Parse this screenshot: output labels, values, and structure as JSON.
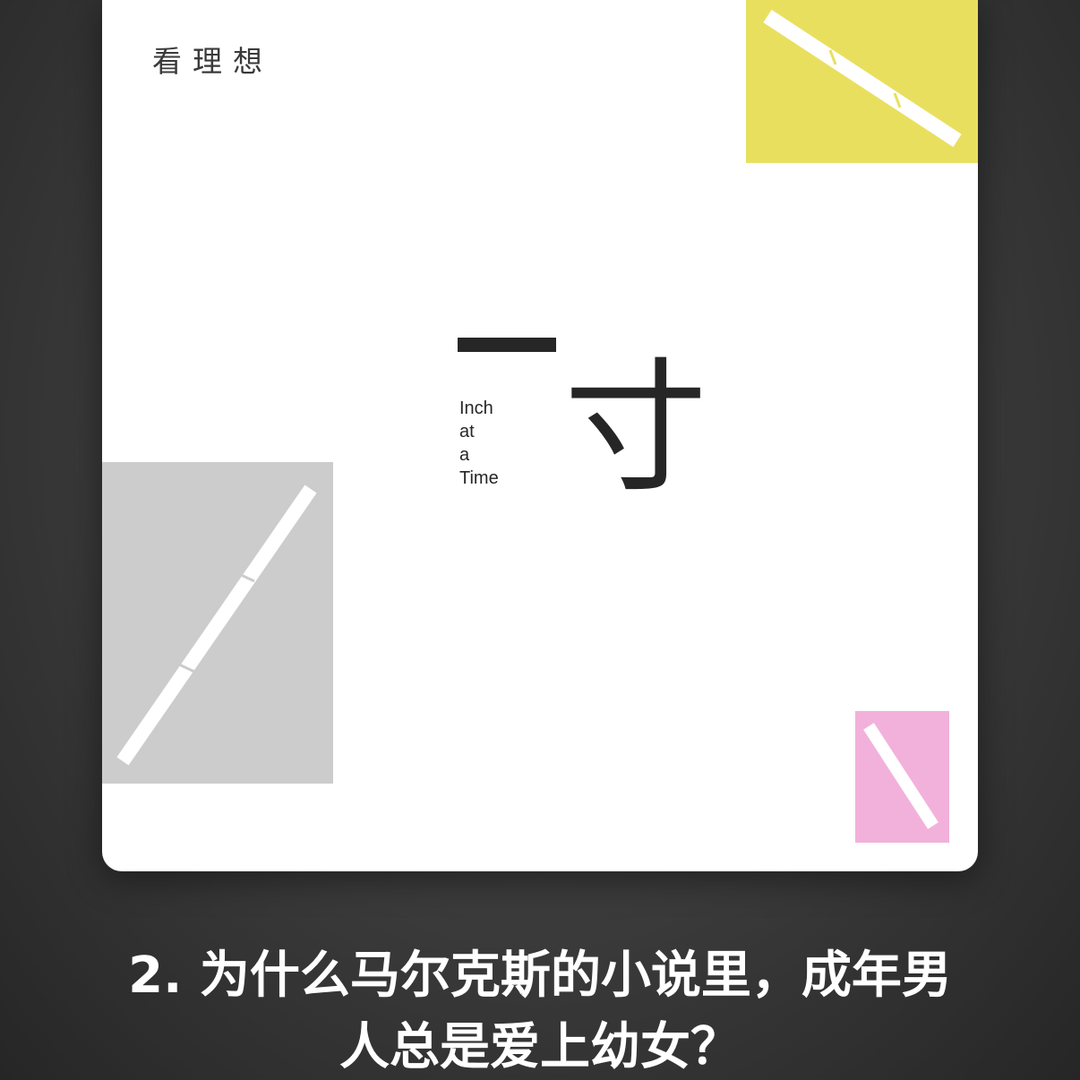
{
  "cover": {
    "publisher": "看理想",
    "title_first_char": "一",
    "title_second_char": "寸",
    "subtitle_lines": [
      "Inch",
      "at",
      "a",
      "Time"
    ],
    "colors": {
      "yellow": "#e9df5f",
      "gray": "#cccccc",
      "pink": "#f2b1da",
      "ink": "#262626"
    }
  },
  "episode": {
    "title_line1": "2. 为什么马尔克斯的小说里，成年男",
    "title_line2": "人总是爱上幼女？"
  }
}
